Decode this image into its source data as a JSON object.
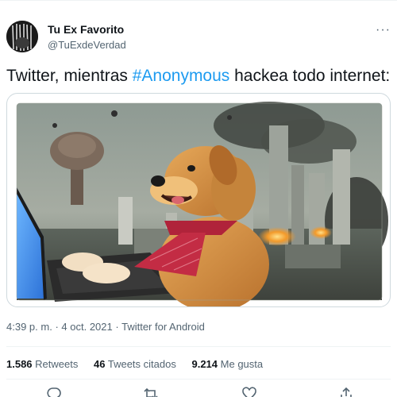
{
  "tweet": {
    "author_name": "Tu Ex Favorito",
    "author_handle": "@TuExdeVerdad",
    "text_before": "Twitter, mientras ",
    "hashtag": "#Anonymous",
    "text_after": " hackea todo internet:",
    "time": "4:39 p. m.",
    "date": "4 oct. 2021",
    "source": "Twitter for Android",
    "separator": "·"
  },
  "stats": {
    "retweets_count": "1.586",
    "retweets_label": "Retweets",
    "quotes_count": "46",
    "quotes_label": "Tweets citados",
    "likes_count": "9.214",
    "likes_label": "Me gusta"
  },
  "icons": {
    "more": "more-dots-icon",
    "reply": "reply-icon",
    "retweet": "retweet-icon",
    "like": "heart-icon",
    "share": "share-icon"
  },
  "colors": {
    "accent": "#1d9bf0",
    "text": "#0f1419",
    "secondary": "#536471",
    "divider": "#eff3f4"
  }
}
